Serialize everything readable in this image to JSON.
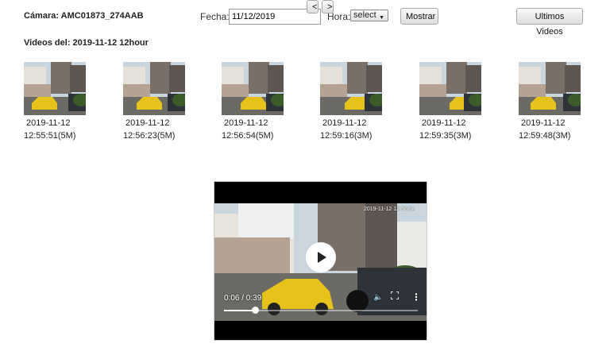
{
  "header": {
    "camera_label": "Cámara: AMC01873_274AAB",
    "fecha_label": "Fecha:",
    "fecha_value": "11/12/2019",
    "hora_label": "Hora:",
    "hora_selected": "select",
    "mostrar_label": "Mostrar",
    "ultimos_label": "Ultimos Videos"
  },
  "videos_heading": "Videos del: 2019-11-12 12hour",
  "thumbnails": [
    {
      "date": "2019-11-12",
      "time": "12:55:51(5M)"
    },
    {
      "date": "2019-11-12",
      "time": "12:56:23(5M)"
    },
    {
      "date": "2019-11-12",
      "time": "12:56:54(5M)"
    },
    {
      "date": "2019-11-12",
      "time": "12:59:16(3M)"
    },
    {
      "date": "2019-11-12",
      "time": "12:59:35(3M)"
    },
    {
      "date": "2019-11-12",
      "time": "12:59:48(3M)"
    }
  ],
  "pager": {
    "prev_label": "<",
    "next_label": ">"
  },
  "player": {
    "time_text": "0:06 / 0:39",
    "progress": 0.16,
    "overlay_timestamp": "2019-11-12 12:56:54"
  },
  "colors": {
    "taxi_yellow": "#e6c21a",
    "sky": "#c9d6df",
    "building": "#7a6f66"
  },
  "icons": [
    "play-icon",
    "volume-icon",
    "fullscreen-icon",
    "more-vert-icon"
  ]
}
